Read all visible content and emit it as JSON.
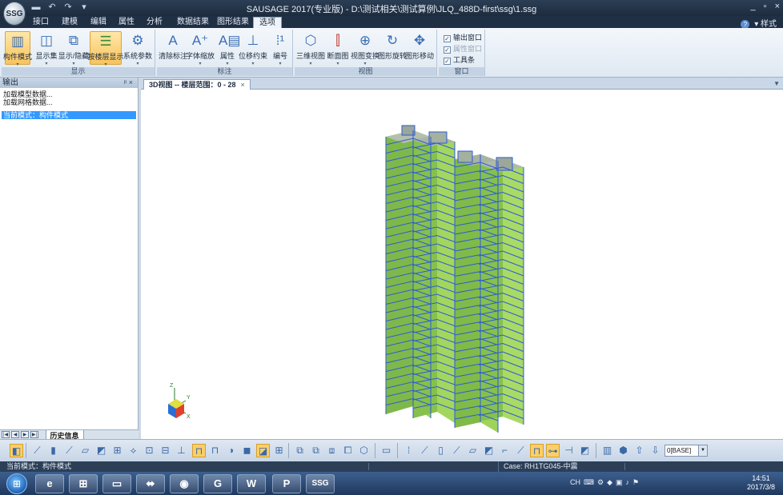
{
  "app": {
    "logo": "SSG",
    "title": "SAUSAGE 2017(专业版) - D:\\测试相关\\测试算例\\JLQ_488D-first\\ssg\\1.ssg",
    "window_controls": [
      "_",
      "▫",
      "×"
    ]
  },
  "menu": {
    "tabs": [
      "接口",
      "建模",
      "编辑",
      "属性",
      "分析",
      "数据结果",
      "图形结果",
      "选项"
    ],
    "active_tab": "选项",
    "style_label": "样式"
  },
  "ribbon": {
    "groups": [
      {
        "label": "显示",
        "buttons": [
          "构件模式",
          "显示集",
          "显示/隐藏",
          "按楼层显示",
          "系统参数"
        ]
      },
      {
        "label": "标注",
        "buttons": [
          "清除标注",
          "字体缩放",
          "属性",
          "位移约束",
          "编号"
        ]
      },
      {
        "label": "视图",
        "buttons": [
          "三维视图",
          "断面图",
          "视图变换",
          "图形旋转",
          "图形移动"
        ]
      },
      {
        "label": "窗口",
        "checkboxes": [
          {
            "label": "输出窗口",
            "checked": true,
            "enabled": true
          },
          {
            "label": "属性窗口",
            "checked": true,
            "enabled": false
          },
          {
            "label": "工具条",
            "checked": true,
            "enabled": true
          }
        ]
      }
    ],
    "active_buttons": [
      "构件模式",
      "按楼层显示"
    ]
  },
  "output_panel": {
    "title": "输出",
    "pin": "ᵖ ×",
    "lines": [
      "加载模型数据...",
      "加载网格数据..."
    ],
    "current_mode": "当前模式：构件模式",
    "history_tab": "历史信息"
  },
  "document": {
    "tab_title": "3D视图 -- 楼层范围：0 - 28",
    "close": "×"
  },
  "axes": {
    "z": "Z",
    "y": "Y",
    "x": "X"
  },
  "toolbar": {
    "layer_select": "0[BASE]"
  },
  "status": {
    "mode": "当前模式：构件模式",
    "case": "Case: RH1TG045-中震"
  },
  "taskbar": {
    "apps": [
      "ie-icon",
      "network-icon",
      "folder-icon",
      "device-icon",
      "chrome-icon",
      "gm-icon",
      "word-icon",
      "powerpoint-icon",
      "ssg-icon"
    ],
    "app_labels": [
      "e",
      "⊞",
      "▭",
      "⬌",
      "◉",
      "G",
      "W",
      "P",
      "SSG"
    ],
    "tray_text": "CH",
    "time": "14:51",
    "date": "2017/3/8"
  },
  "colors": {
    "titlebar": "#1e2c3e",
    "ribbon_active": "#f7c35d",
    "selection": "#3399ff",
    "wall_green": "#8cc63f",
    "frame_blue": "#2c5bd6",
    "slab_gray": "#a6b1a3"
  }
}
